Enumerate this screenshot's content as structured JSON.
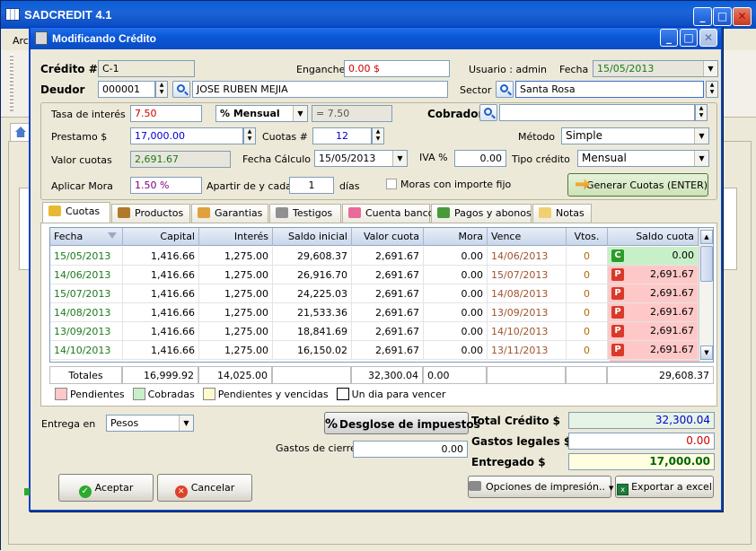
{
  "outer": {
    "title": "SADCREDIT 4.1",
    "menu_first": "Arc"
  },
  "dialog": {
    "title": "Modificando Crédito",
    "credito_label": "Crédito #",
    "credito_value": "C-1",
    "enganche_label": "Enganche",
    "enganche_value": "0.00 $",
    "usuario_label": "Usuario : admin",
    "fecha_label": "Fecha",
    "fecha_value": "15/05/2013",
    "deudor_label": "Deudor",
    "deudor_id": "000001",
    "deudor_name": "JOSE RUBEN MEJIA",
    "sector_label": "Sector",
    "sector_value": "Santa Rosa"
  },
  "params": {
    "tasa_label": "Tasa de interés",
    "tasa_value": "7.50",
    "periodo_value": "% Mensual",
    "tasa_calc": "= 7.50",
    "cobrador_label": "Cobrador",
    "cobrador_value": "",
    "prestamo_label": "Prestamo $",
    "prestamo_value": "17,000.00",
    "cuotas_label": "Cuotas #",
    "cuotas_value": "12",
    "metodo_label": "Método",
    "metodo_value": "Simple",
    "valor_cuotas_label": "Valor cuotas",
    "valor_cuotas_value": "2,691.67",
    "fecha_calculo_label": "Fecha Cálculo",
    "fecha_calculo_value": "15/05/2013",
    "iva_label": "IVA %",
    "iva_value": "0.00",
    "tipo_credito_label": "Tipo crédito",
    "tipo_credito_value": "Mensual",
    "aplicar_mora_label": "Aplicar Mora",
    "aplicar_mora_value": "1.50 %",
    "apartir_label": "Apartir de y cada",
    "apartir_value": "1",
    "dias_label": "días",
    "moras_label": "Moras con importe  fijo",
    "generar_label": "Generar Cuotas (ENTER)"
  },
  "tabs": [
    {
      "label": "Cuotas",
      "icon": "coins-icon",
      "color": "#E8B830"
    },
    {
      "label": "Productos",
      "icon": "box-icon",
      "color": "#B07A2A"
    },
    {
      "label": "Garantias",
      "icon": "person-icon",
      "color": "#E0A040"
    },
    {
      "label": "Testigos",
      "icon": "user-icon",
      "color": "#909090"
    },
    {
      "label": "Cuenta banco",
      "icon": "piggy-bank-icon",
      "color": "#E86A9A"
    },
    {
      "label": "Pagos y abonos",
      "icon": "money-icon",
      "color": "#4A9A3A"
    },
    {
      "label": "Notas",
      "icon": "note-icon",
      "color": "#F0D070"
    }
  ],
  "grid": {
    "headers": [
      "Fecha",
      "Capital",
      "Interés",
      "Saldo inicial",
      "Valor cuota",
      "Mora",
      "Vence",
      "Vtos.",
      "Saldo cuota"
    ],
    "rows": [
      {
        "fecha": "15/05/2013",
        "capital": "1,416.66",
        "interes": "1,275.00",
        "saldo_inicial": "29,608.37",
        "valor_cuota": "2,691.67",
        "mora": "0.00",
        "vence": "14/06/2013",
        "vtos": "0",
        "status": "C",
        "saldo_cuota": "0.00"
      },
      {
        "fecha": "14/06/2013",
        "capital": "1,416.66",
        "interes": "1,275.00",
        "saldo_inicial": "26,916.70",
        "valor_cuota": "2,691.67",
        "mora": "0.00",
        "vence": "15/07/2013",
        "vtos": "0",
        "status": "P",
        "saldo_cuota": "2,691.67"
      },
      {
        "fecha": "15/07/2013",
        "capital": "1,416.66",
        "interes": "1,275.00",
        "saldo_inicial": "24,225.03",
        "valor_cuota": "2,691.67",
        "mora": "0.00",
        "vence": "14/08/2013",
        "vtos": "0",
        "status": "P",
        "saldo_cuota": "2,691.67"
      },
      {
        "fecha": "14/08/2013",
        "capital": "1,416.66",
        "interes": "1,275.00",
        "saldo_inicial": "21,533.36",
        "valor_cuota": "2,691.67",
        "mora": "0.00",
        "vence": "13/09/2013",
        "vtos": "0",
        "status": "P",
        "saldo_cuota": "2,691.67"
      },
      {
        "fecha": "13/09/2013",
        "capital": "1,416.66",
        "interes": "1,275.00",
        "saldo_inicial": "18,841.69",
        "valor_cuota": "2,691.67",
        "mora": "0.00",
        "vence": "14/10/2013",
        "vtos": "0",
        "status": "P",
        "saldo_cuota": "2,691.67"
      },
      {
        "fecha": "14/10/2013",
        "capital": "1,416.66",
        "interes": "1,275.00",
        "saldo_inicial": "16,150.02",
        "valor_cuota": "2,691.67",
        "mora": "0.00",
        "vence": "13/11/2013",
        "vtos": "0",
        "status": "P",
        "saldo_cuota": "2,691.67"
      }
    ],
    "totals": {
      "label": "Totales",
      "capital": "16,999.92",
      "interes": "14,025.00",
      "valor_cuota": "32,300.04",
      "mora": "0.00",
      "saldo_cuota": "29,608.37"
    }
  },
  "legend": [
    {
      "label": "Pendientes",
      "color": "#FFC8C8"
    },
    {
      "label": "Cobradas",
      "color": "#C8F0C8"
    },
    {
      "label": "Pendientes y vencidas",
      "color": "#FFFACD"
    },
    {
      "label": "Un dia para vencer",
      "color": "#FFFFFF"
    }
  ],
  "bottom": {
    "entrega_label": "Entrega en",
    "entrega_value": "Pesos",
    "desglose_label": "Desglose de impuestos",
    "gastos_cierre_label": "Gastos de cierre",
    "gastos_cierre_value": "0.00",
    "total_credito_label": "Total Crédito $",
    "total_credito_value": "32,300.04",
    "gastos_legales_label": "Gastos legales $",
    "gastos_legales_value": "0.00",
    "entregado_label": "Entregado $",
    "entregado_value": "17,000.00",
    "aceptar_label": "Aceptar",
    "cancelar_label": "Cancelar",
    "opciones_label": "Opciones de impresión..",
    "exportar_label": "Exportar a excel"
  },
  "colors": {
    "status_c": "#2E9A2E",
    "status_p": "#D83A2A",
    "row_c": "#C8F0C8",
    "row_p": "#FFC8C8"
  }
}
